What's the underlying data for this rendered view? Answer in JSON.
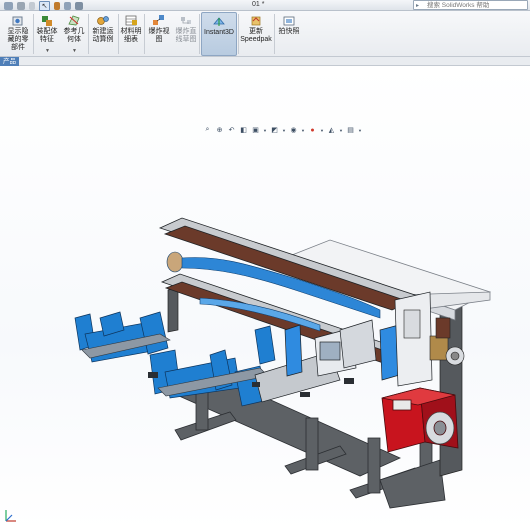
{
  "titlebar": {
    "document_title": "01 *",
    "search_placeholder": "搜索 SolidWorks 帮助"
  },
  "ribbon": {
    "buttons": [
      {
        "label": "显示隐\n藏的零\n部件"
      },
      {
        "label": "装配体\n特征"
      },
      {
        "label": "参考几\n何体"
      },
      {
        "label": "新建运\n动算例"
      },
      {
        "label": "材料明\n细表"
      },
      {
        "label": "爆炸视\n图"
      },
      {
        "label": "爆炸直\n线草图"
      },
      {
        "label": "Instant3D"
      },
      {
        "label": "更新\nSpeedpak"
      },
      {
        "label": "拍快照"
      }
    ]
  },
  "tabs": {
    "active_label": "产品"
  },
  "colors": {
    "machine_blue": "#1f7fd1",
    "motor_red": "#c8141e",
    "frame_gray": "#5f6468",
    "rail_brown": "#6b3a2a",
    "ribbon_active": "#b8cbe0"
  },
  "icons": {
    "hud": [
      "zoom-to-fit-icon",
      "zoom-area-icon",
      "previous-view-icon",
      "section-view-icon",
      "view-orientation-icon",
      "display-style-icon",
      "hide-show-icon",
      "edit-appearance-icon",
      "apply-scene-icon",
      "view-settings-icon"
    ]
  }
}
